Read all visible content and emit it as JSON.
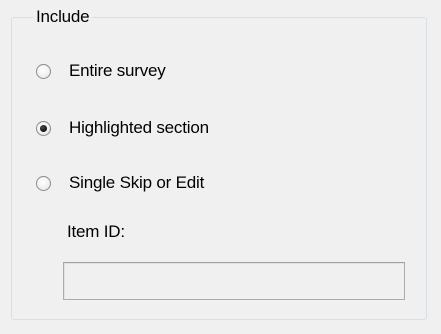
{
  "group": {
    "legend": "Include"
  },
  "options": [
    {
      "label": "Entire survey",
      "checked": false
    },
    {
      "label": "Highlighted section",
      "checked": true
    },
    {
      "label": "Single Skip or Edit",
      "checked": false
    }
  ],
  "item_id": {
    "label": "Item ID:",
    "value": "",
    "enabled": false
  }
}
